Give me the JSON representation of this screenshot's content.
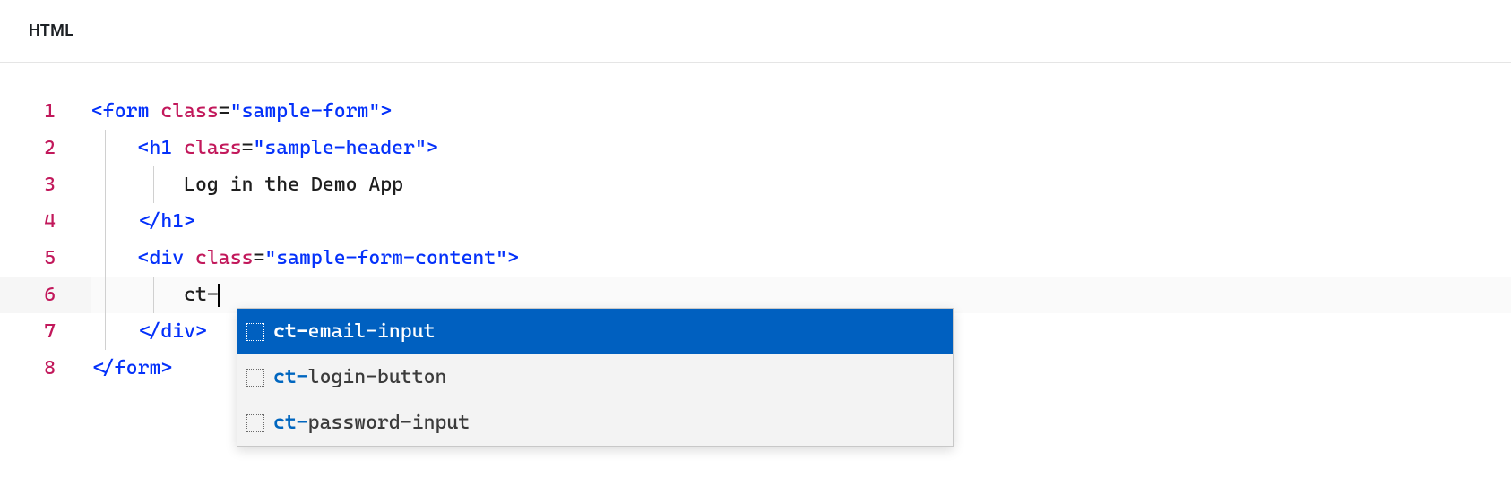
{
  "tab": {
    "label": "HTML"
  },
  "editor": {
    "lineNumbers": [
      "1",
      "2",
      "3",
      "4",
      "5",
      "6",
      "7",
      "8"
    ],
    "lines": [
      {
        "indent": 0,
        "tokens": [
          {
            "t": "bracket",
            "v": "<"
          },
          {
            "t": "tag",
            "v": "form"
          },
          {
            "t": "space",
            "v": " "
          },
          {
            "t": "attr",
            "v": "class"
          },
          {
            "t": "equals",
            "v": "="
          },
          {
            "t": "value",
            "v": "\"sample-form\""
          },
          {
            "t": "bracket",
            "v": ">"
          }
        ]
      },
      {
        "indent": 1,
        "tokens": [
          {
            "t": "bracket",
            "v": "<"
          },
          {
            "t": "tag",
            "v": "h1"
          },
          {
            "t": "space",
            "v": " "
          },
          {
            "t": "attr",
            "v": "class"
          },
          {
            "t": "equals",
            "v": "="
          },
          {
            "t": "value",
            "v": "\"sample-header\""
          },
          {
            "t": "bracket",
            "v": ">"
          }
        ]
      },
      {
        "indent": 2,
        "tokens": [
          {
            "t": "text",
            "v": "Log in the Demo App"
          }
        ]
      },
      {
        "indent": 1,
        "tokens": [
          {
            "t": "bracket",
            "v": "</"
          },
          {
            "t": "tag",
            "v": "h1"
          },
          {
            "t": "bracket",
            "v": ">"
          }
        ]
      },
      {
        "indent": 1,
        "tokens": [
          {
            "t": "bracket",
            "v": "<"
          },
          {
            "t": "tag",
            "v": "div"
          },
          {
            "t": "space",
            "v": " "
          },
          {
            "t": "attr",
            "v": "class"
          },
          {
            "t": "equals",
            "v": "="
          },
          {
            "t": "value",
            "v": "\"sample-form-content\""
          },
          {
            "t": "bracket",
            "v": ">"
          }
        ]
      },
      {
        "indent": 2,
        "highlighted": true,
        "tokens": [
          {
            "t": "text",
            "v": "ct-"
          }
        ],
        "cursor": true
      },
      {
        "indent": 1,
        "tokens": [
          {
            "t": "bracket",
            "v": "</"
          },
          {
            "t": "tag",
            "v": "div"
          },
          {
            "t": "bracket",
            "v": ">"
          }
        ]
      },
      {
        "indent": 0,
        "tokens": [
          {
            "t": "bracket",
            "v": "</"
          },
          {
            "t": "tag",
            "v": "form"
          },
          {
            "t": "bracket",
            "v": ">"
          }
        ]
      }
    ]
  },
  "autocomplete": {
    "items": [
      {
        "match": "ct-",
        "rest": "email-input",
        "selected": true
      },
      {
        "match": "ct-",
        "rest": "login-button",
        "selected": false
      },
      {
        "match": "ct-",
        "rest": "password-input",
        "selected": false
      }
    ]
  }
}
